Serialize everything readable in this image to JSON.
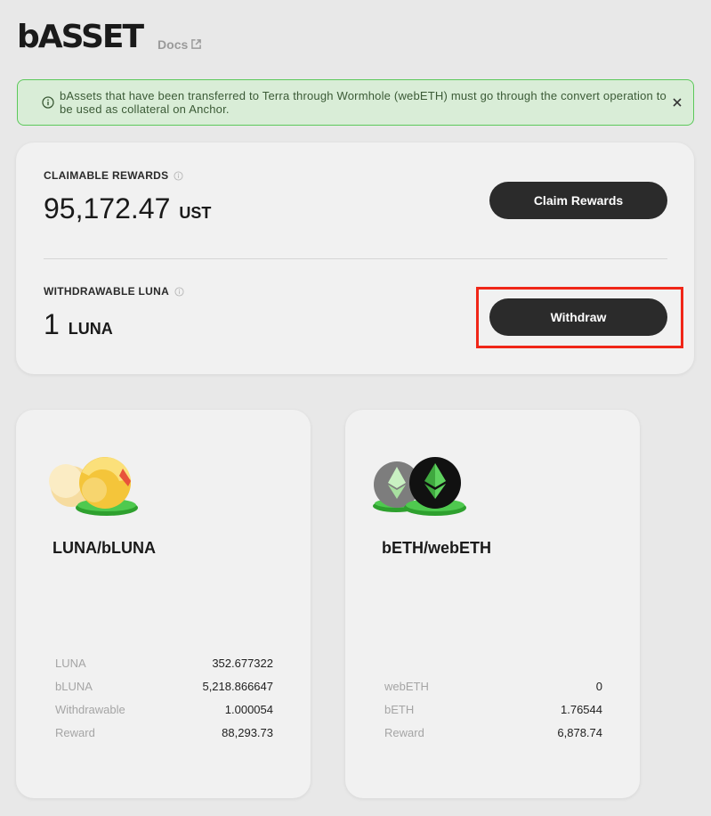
{
  "header": {
    "brand": "bASSET",
    "docs_label": "Docs"
  },
  "alert": {
    "message": "bAssets that have been transferred to Terra through Wormhole (webETH) must go through the convert operation to be used as collateral on Anchor."
  },
  "rewards": {
    "claimable_label": "CLAIMABLE REWARDS",
    "claimable_amount": "95,172.47",
    "claimable_unit": "UST",
    "claim_button": "Claim Rewards",
    "withdrawable_label": "WITHDRAWABLE LUNA",
    "withdrawable_amount": "1",
    "withdrawable_unit": "LUNA",
    "withdraw_button": "Withdraw"
  },
  "assets": [
    {
      "title": "LUNA/bLUNA",
      "stats": [
        {
          "label": "LUNA",
          "value": "352.677322"
        },
        {
          "label": "bLUNA",
          "value": "5,218.866647"
        },
        {
          "label": "Withdrawable",
          "value": "1.000054"
        },
        {
          "label": "Reward",
          "value": "88,293.73"
        }
      ]
    },
    {
      "title": "bETH/webETH",
      "stats": [
        {
          "label": "webETH",
          "value": "0"
        },
        {
          "label": "bETH",
          "value": "1.76544"
        },
        {
          "label": "Reward",
          "value": "6,878.74"
        }
      ]
    }
  ],
  "colors": {
    "accent_green": "#4fc94f",
    "alert_bg": "#d9edd7",
    "button_dark": "#2b2b2b",
    "highlight_red": "#f02618"
  },
  "icons": [
    "external-link-icon",
    "info-icon",
    "close-icon",
    "luna-logo-icon",
    "eth-logo-icon"
  ]
}
